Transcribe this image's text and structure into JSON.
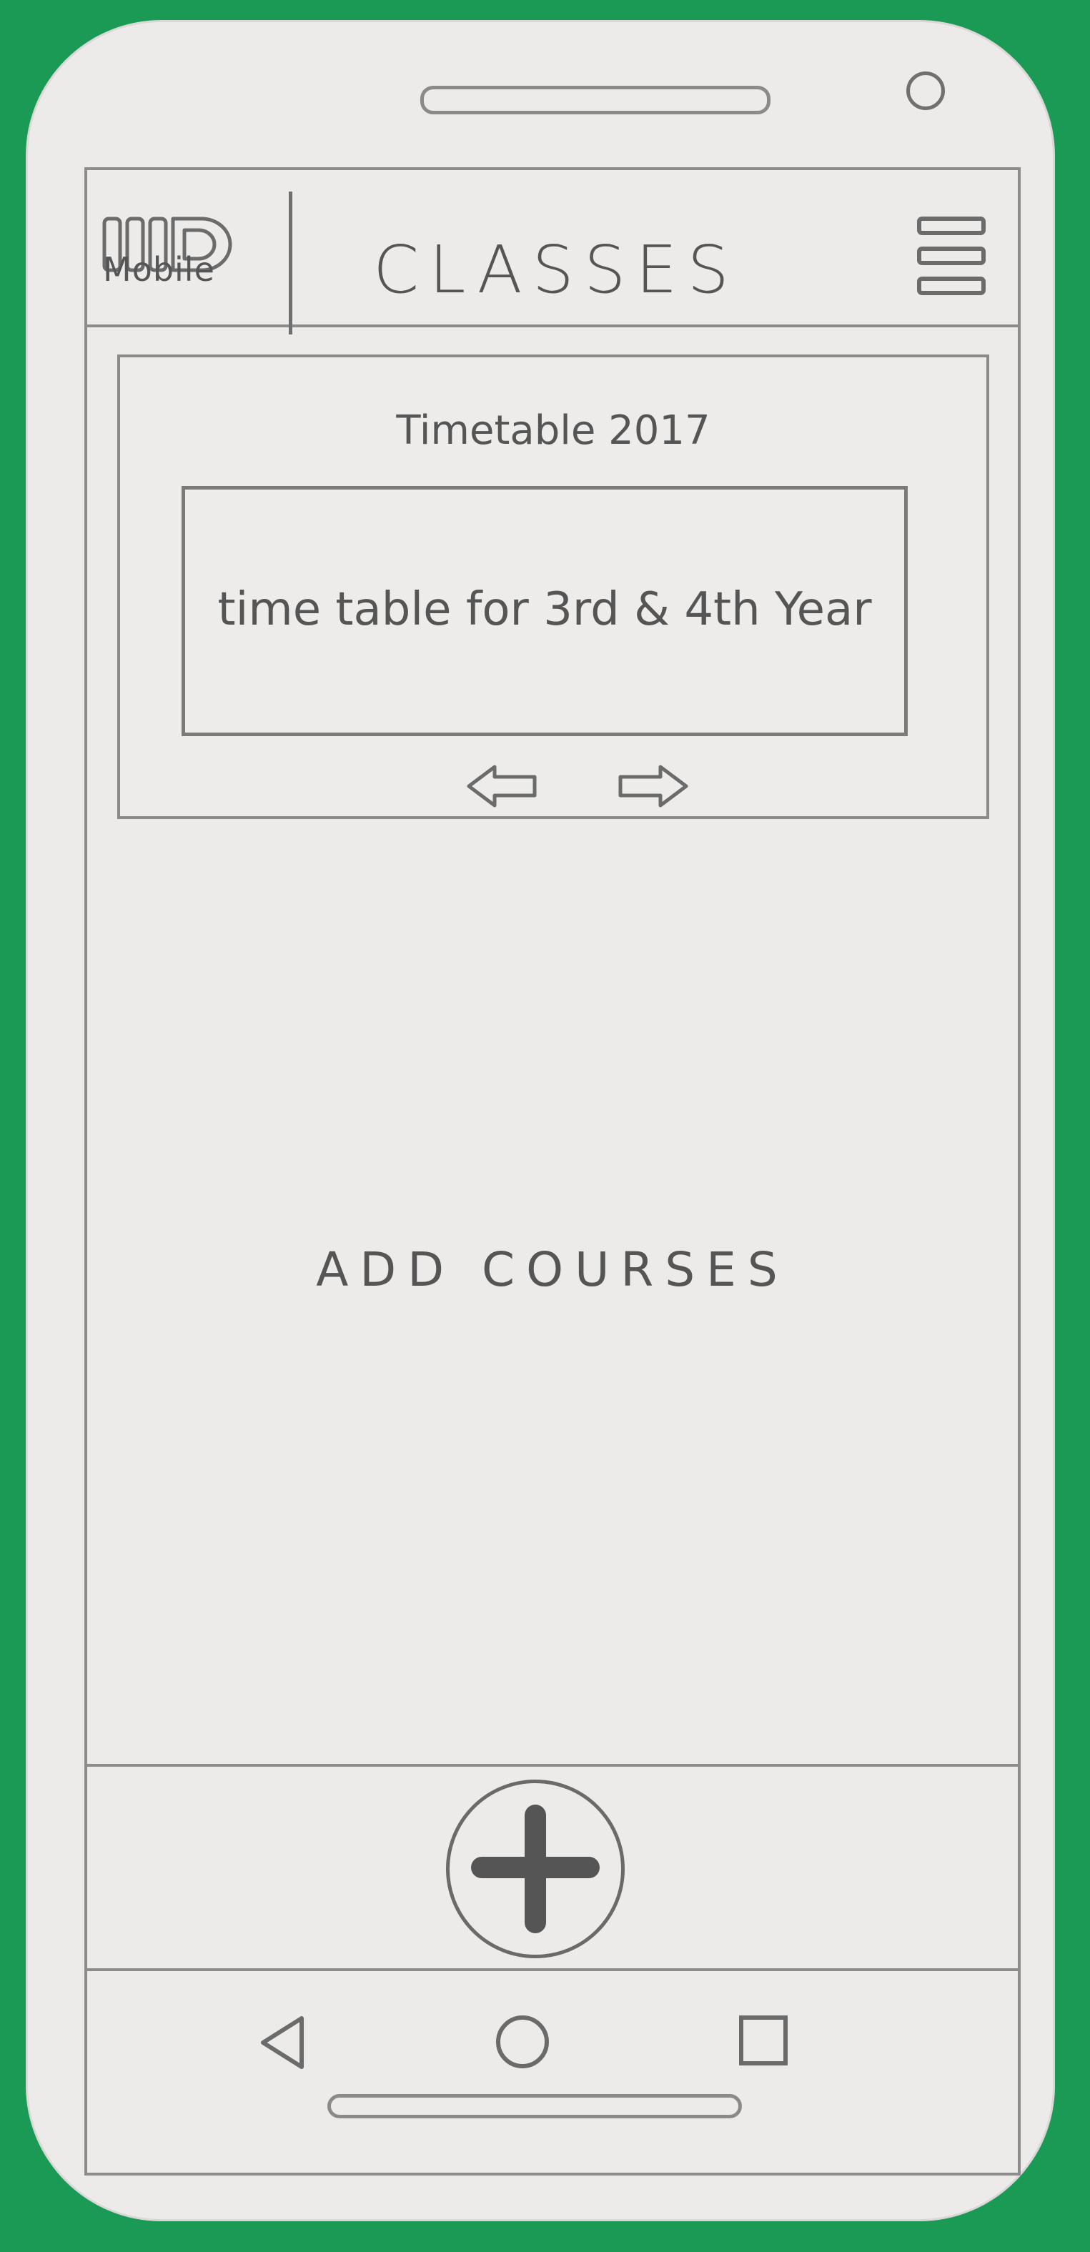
{
  "app": {
    "logo_text": "Mobile",
    "title": "CLASSES"
  },
  "header": {
    "menu_icon": "hamburger-menu-icon"
  },
  "timetable_card": {
    "title": "Timetable 2017",
    "slide_text": "time table for 3rd & 4th Year",
    "prev_icon": "arrow-left-icon",
    "next_icon": "arrow-right-icon"
  },
  "main": {
    "empty_state_text": "ADD COURSES"
  },
  "bottom_bar": {
    "fab_icon": "plus-icon"
  },
  "android_nav": {
    "back_icon": "triangle-back-icon",
    "home_icon": "circle-home-icon",
    "recent_icon": "square-recents-icon"
  },
  "colors": {
    "background": "#1a9a55",
    "paper": "#ecebea",
    "pencil": "#6b6b6b"
  }
}
